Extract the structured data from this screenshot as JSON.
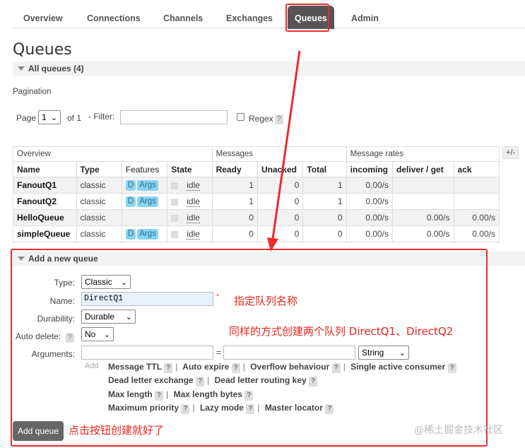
{
  "nav": {
    "tabs": [
      {
        "label": "Overview"
      },
      {
        "label": "Connections"
      },
      {
        "label": "Channels"
      },
      {
        "label": "Exchanges"
      },
      {
        "label": "Queues"
      },
      {
        "label": "Admin"
      }
    ],
    "active": "Queues"
  },
  "page": {
    "title": "Queues",
    "all_queues": "All queues (4)"
  },
  "pagination": {
    "heading": "Pagination",
    "page_label": "Page",
    "page_value": "1",
    "of_label": "of 1",
    "filter_label": "- Filter:",
    "filter_value": "",
    "regex_label": "Regex",
    "help": "?"
  },
  "table": {
    "groups": [
      "Overview",
      "Messages",
      "Message rates"
    ],
    "plus_minus": "+/-",
    "headers": [
      "Name",
      "Type",
      "Features",
      "State",
      "Ready",
      "Unacked",
      "Total",
      "incoming",
      "deliver / get",
      "ack"
    ],
    "rows": [
      {
        "name": "FanoutQ1",
        "type": "classic",
        "features": [
          "D",
          "Args"
        ],
        "state": "idle",
        "ready": "1",
        "unacked": "0",
        "total": "1",
        "incoming": "0.00/s",
        "deliver_get": "",
        "ack": ""
      },
      {
        "name": "FanoutQ2",
        "type": "classic",
        "features": [
          "D",
          "Args"
        ],
        "state": "idle",
        "ready": "1",
        "unacked": "0",
        "total": "1",
        "incoming": "0.00/s",
        "deliver_get": "",
        "ack": ""
      },
      {
        "name": "HelloQueue",
        "type": "classic",
        "features": [],
        "state": "idle",
        "ready": "0",
        "unacked": "0",
        "total": "0",
        "incoming": "0.00/s",
        "deliver_get": "0.00/s",
        "ack": "0.00/s"
      },
      {
        "name": "simpleQueue",
        "type": "classic",
        "features": [
          "D",
          "Args"
        ],
        "state": "idle",
        "ready": "0",
        "unacked": "0",
        "total": "0",
        "incoming": "0.00/s",
        "deliver_get": "0.00/s",
        "ack": "0.00/s"
      }
    ]
  },
  "add_queue": {
    "heading": "Add a new queue",
    "type_label": "Type:",
    "type_value": "Classic",
    "name_label": "Name:",
    "name_value": "DirectQ1",
    "required_mark": "*",
    "durability_label": "Durability:",
    "durability_value": "Durable",
    "auto_delete_label": "Auto delete:",
    "auto_delete_value": "No",
    "arguments_label": "Arguments:",
    "arg_key": "",
    "arg_equals": "=",
    "arg_value": "",
    "arg_type": "String",
    "add_label": "Add",
    "arg_links_line1": [
      "Message TTL",
      "Auto expire",
      "Overflow behaviour",
      "Single active consumer"
    ],
    "arg_links_line2": [
      "Dead letter exchange",
      "Dead letter routing key"
    ],
    "arg_links_line3": [
      "Max length",
      "Max length bytes"
    ],
    "arg_links_line4": [
      "Maximum priority",
      "Lazy mode",
      "Master locator"
    ],
    "submit": "Add queue"
  },
  "annotations": {
    "name_note": "指定队列名称",
    "create_note": "同样的方式创建两个队列 DirectQ1、DirectQ2",
    "button_note": "点击按钮创建就好了",
    "color": "#e8261f"
  },
  "watermark": "@稀土掘金技术社区"
}
